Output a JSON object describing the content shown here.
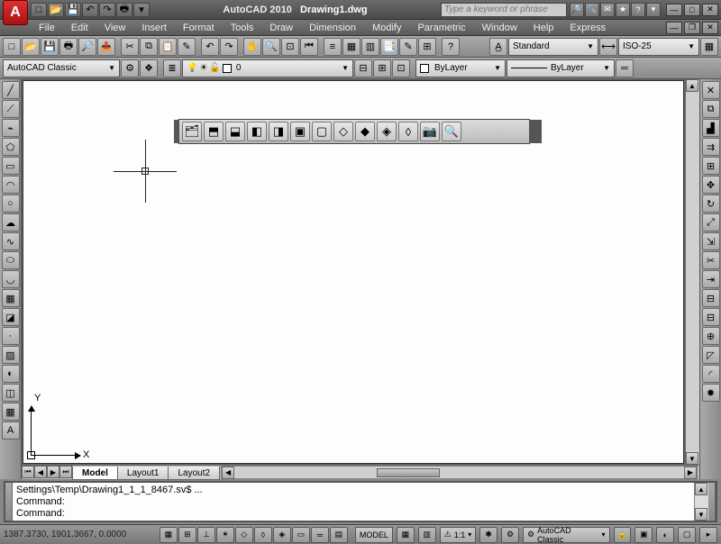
{
  "title": {
    "app": "AutoCAD 2010",
    "file": "Drawing1.dwg"
  },
  "search": {
    "placeholder": "Type a keyword or phrase"
  },
  "menu": [
    "File",
    "Edit",
    "View",
    "Insert",
    "Format",
    "Tools",
    "Draw",
    "Dimension",
    "Modify",
    "Parametric",
    "Window",
    "Help",
    "Express"
  ],
  "toolbar2": {
    "workspace": "AutoCAD Classic",
    "layer_current": "0",
    "color": "ByLayer",
    "linetype": "ByLayer",
    "textstyle": "Standard",
    "dimstyle": "ISO-25"
  },
  "ucs": {
    "x": "X",
    "y": "Y"
  },
  "tabs": [
    "Model",
    "Layout1",
    "Layout2"
  ],
  "command": {
    "line1": "Settings\\Temp\\Drawing1_1_1_8467.sv$ ...",
    "line2": "Command:",
    "prompt": "Command:"
  },
  "status": {
    "coords": "1387.3730, 1901.3667, 0.0000",
    "space": "MODEL",
    "scale": "1:1",
    "workspace": "AutoCAD Classic"
  },
  "icons": {
    "new": "□",
    "open": "📂",
    "save": "💾",
    "undo": "↶",
    "redo": "↷",
    "print": "🖶",
    "cut": "✂",
    "copy": "⧉",
    "paste": "📋",
    "match": "✎",
    "pan": "✋",
    "zoom": "🔍",
    "line": "╱",
    "cline": "⟋",
    "pline": "⌁",
    "poly": "⬠",
    "rect": "▭",
    "arc": "◠",
    "circle": "○",
    "spline": "∿",
    "ellipse": "⬭",
    "earc": "◡",
    "block": "▦",
    "point": "·",
    "hatch": "▨",
    "grad": "◐",
    "region": "◫",
    "table": "▦",
    "text": "A",
    "erase": "✕",
    "copy2": "⧉",
    "mirror": "▟",
    "offset": "⇉",
    "array": "⊞",
    "move": "✥",
    "rotate": "↻",
    "scale": "⤢",
    "stretch": "⇲",
    "trim": "✂",
    "extend": "⇥",
    "break": "⊟",
    "join": "⊕",
    "chamfer": "◸",
    "fillet": "◜",
    "explode": "✹",
    "dist": "⟷",
    "props": "≡",
    "nav": "◈",
    "cube": "◳",
    "wheel": "◎",
    "snap": "▦",
    "grid": "⊞",
    "ortho": "⊥",
    "polar": "✶",
    "osnap": "◇",
    "otrack": "◊",
    "ducs": "◈",
    "dyn": "▭",
    "lw": "═",
    "qp": "▤",
    "lock": "🔒",
    "max": "▣",
    "tray": "▸",
    "clean": "▢"
  }
}
